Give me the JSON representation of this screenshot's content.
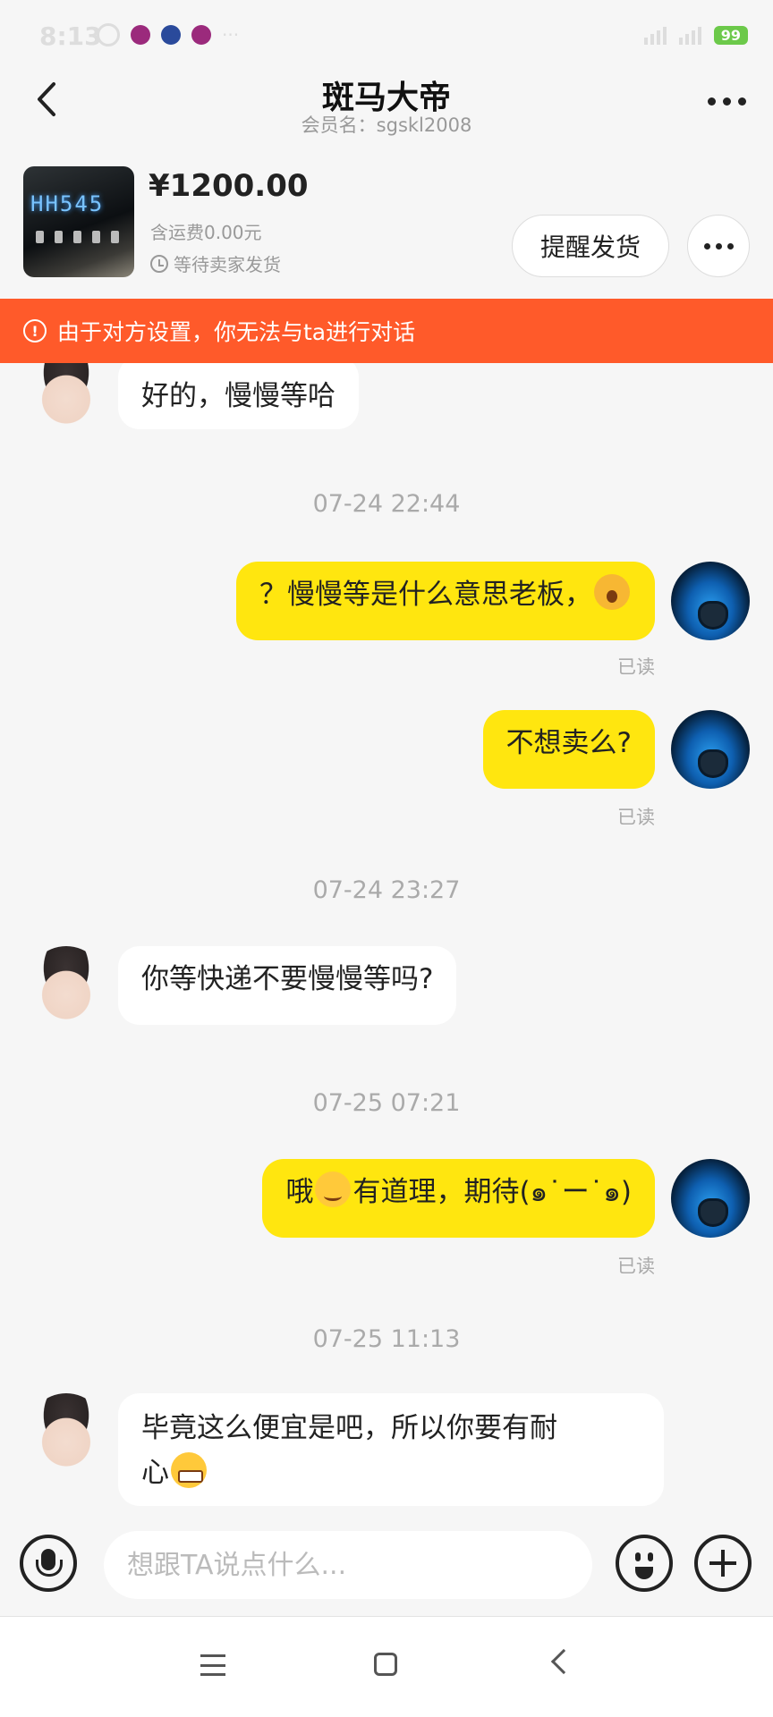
{
  "status_bar": {
    "time": "8:13",
    "battery": "99"
  },
  "header": {
    "title": "斑马大帝",
    "subtitle": "会员名：sgskl2008"
  },
  "product": {
    "thumb_text": "HH545",
    "price": "¥1200.00",
    "shipping": "含运费0.00元",
    "status": "等待卖家发货",
    "remind_button": "提醒发货"
  },
  "warning": {
    "text": "由于对方设置，你无法与ta进行对话"
  },
  "messages": {
    "m1": "好的，慢慢等哈",
    "ts1": "07-24 22:44",
    "m2": "？慢慢等是什么意思老板，",
    "read1": "已读",
    "m3": "不想卖么?",
    "read2": "已读",
    "ts2": "07-24 23:27",
    "m4": "你等快递不要慢慢等吗?",
    "ts3": "07-25 07:21",
    "m5a": "哦",
    "m5b": "有道理，期待(๑˙ー˙๑)",
    "read3": "已读",
    "ts4": "07-25 11:13",
    "m6a": "毕竟这么便宜是吧，所以你要有耐",
    "m6b": "心"
  },
  "input": {
    "placeholder": "想跟TA说点什么..."
  },
  "colors": {
    "warning": "#ff5a2a",
    "bubble_out": "#ffe60f",
    "bubble_in": "#ffffff"
  },
  "icons": {
    "back": "back-chevron-icon",
    "more": "more-dots-icon",
    "clock": "clock-icon",
    "warning": "exclamation-circle-icon",
    "mic": "microphone-icon",
    "emoji": "emoji-face-icon",
    "plus": "plus-icon"
  }
}
